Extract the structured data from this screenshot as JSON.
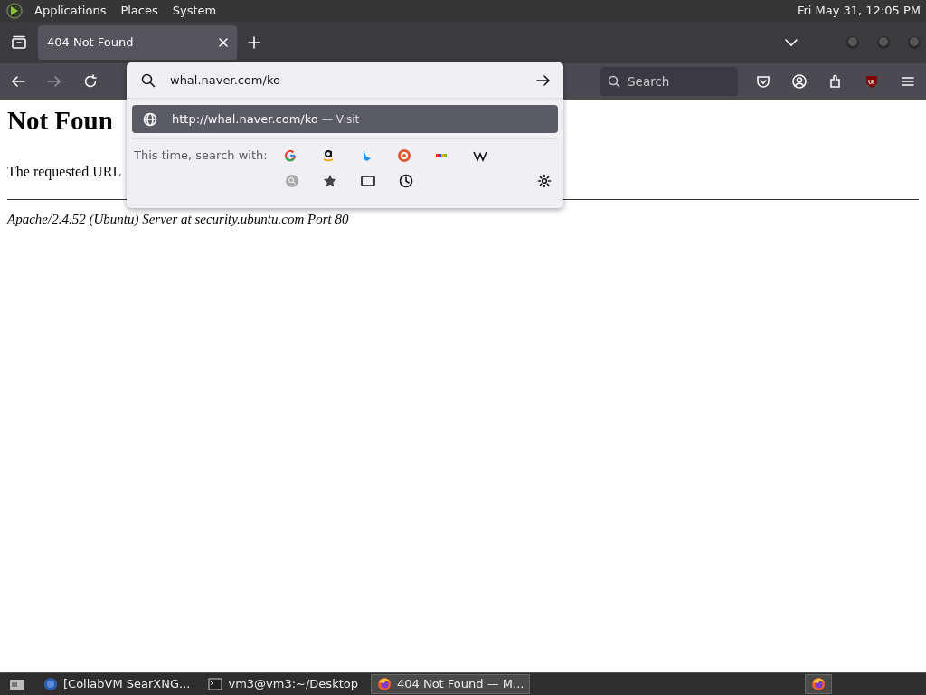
{
  "top_panel": {
    "menus": [
      "Applications",
      "Places",
      "System"
    ],
    "clock": "Fri May 31, 12:05 PM"
  },
  "tabs": [
    {
      "title": "404 Not Found",
      "selected": true
    }
  ],
  "address_bar": {
    "value": "whal.naver.com/ko"
  },
  "search_field": {
    "placeholder": "Search"
  },
  "suggestions": [
    {
      "url": "http://whal.naver.com/ko",
      "action": "— Visit",
      "selected": true
    }
  ],
  "search_with": {
    "label": "This time, search with:"
  },
  "page": {
    "heading": "Not Foun",
    "text": "The requested URL",
    "footer": "Apache/2.4.52 (Ubuntu) Server at security.ubuntu.com Port 80"
  },
  "taskbar": [
    {
      "kind": "browser",
      "title": "[CollabVM SearXNG...",
      "selected": false
    },
    {
      "kind": "terminal",
      "title": "vm3@vm3:~/Desktop",
      "selected": false
    },
    {
      "kind": "firefox",
      "title": "404 Not Found — M...",
      "selected": true
    }
  ]
}
